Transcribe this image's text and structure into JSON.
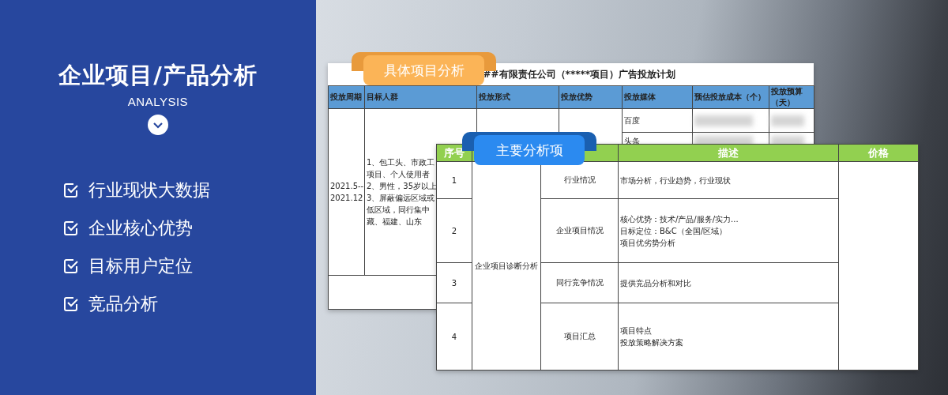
{
  "banner": {
    "title": "企业项目/产品分析",
    "subtitle": "ANALYSIS",
    "features": [
      "行业现状大数据",
      "企业核心优势",
      "目标用户定位",
      "竞品分析"
    ]
  },
  "plan_sheet": {
    "ribbon": "具体项目分析",
    "title": "##有限责任公司（*****项目）广告投放计划",
    "columns": [
      "投放周期",
      "目标人群",
      "投放形式",
      "投放优势",
      "投放媒体",
      "预估投放成本（个）",
      "投放预算（天）"
    ],
    "period_lines": [
      "2021.5--",
      "2021.12"
    ],
    "audience_lines": [
      "1、包工头、市政工",
      "项目、个人使用者",
      "2、男性，35岁以上",
      "3、屏蔽偏远区域或",
      "低区域，同行集中",
      "藏、福建、山东"
    ],
    "media": [
      "百度",
      "头条"
    ]
  },
  "analysis_sheet": {
    "ribbon": "主要分析项",
    "columns": {
      "number": "序号",
      "description": "描述",
      "price": "价格"
    },
    "category": "企业项目诊断分析",
    "rows": [
      {
        "number": "1",
        "item": "行业情况",
        "description": [
          "市场分析，行业趋势，行业现状"
        ]
      },
      {
        "number": "2",
        "item": "企业项目情况",
        "description": [
          "核心优势：技术/产品/服务/实力...",
          "目标定位：B&C（全国/区域）",
          "项目优劣势分析"
        ]
      },
      {
        "number": "3",
        "item": "同行竞争情况",
        "description": [
          "提供竞品分析和对比"
        ]
      },
      {
        "number": "4",
        "item": "项目汇总",
        "description": [
          "项目特点",
          "投放策略解决方案"
        ]
      }
    ]
  }
}
